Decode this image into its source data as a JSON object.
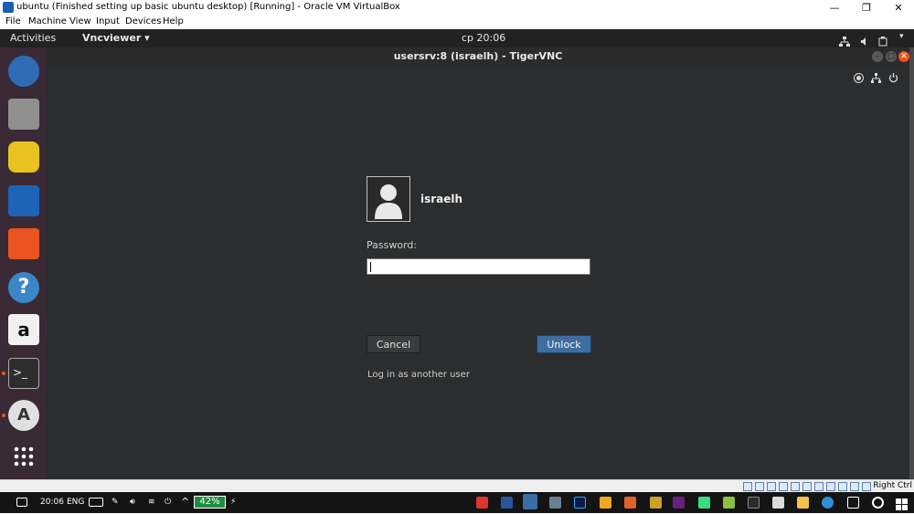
{
  "window": {
    "title": "ubuntu (Finished setting up basic ubuntu desktop) [Running] - Oracle VM VirtualBox",
    "controls": {
      "minimize": "—",
      "maximize": "❐",
      "close": "✕"
    }
  },
  "menu": [
    "File",
    "Machine",
    "View",
    "Input",
    "Devices",
    "Help"
  ],
  "gnome_bar": {
    "activities": "Activities",
    "app_menu": "Vncviewer ▾",
    "clock": "cp 20:06"
  },
  "dock": {
    "items": [
      {
        "name": "Thunderbird",
        "icon": "thunderbird-icon",
        "color": "#2d6db5"
      },
      {
        "name": "Files",
        "icon": "files-icon",
        "color": "#8f8f8f"
      },
      {
        "name": "Rhythmbox",
        "icon": "rhythmbox-icon",
        "color": "#e8c31f"
      },
      {
        "name": "LibreOffice Writer",
        "icon": "writer-icon",
        "color": "#1d63b8"
      },
      {
        "name": "Ubuntu Software",
        "icon": "software-center-icon",
        "color": "#e95420"
      },
      {
        "name": "Help",
        "icon": "help-icon",
        "color": "#3a86c8"
      },
      {
        "name": "Amazon",
        "icon": "amazon-icon",
        "color": "#f0f0f0"
      },
      {
        "name": "Terminal",
        "icon": "terminal-icon",
        "color": "#2e2e2e"
      },
      {
        "name": "Software Updater",
        "icon": "updater-icon",
        "color": "#e0e0e0"
      },
      {
        "name": "Show Applications",
        "icon": "app-grid-icon",
        "color": "#ffffff"
      }
    ]
  },
  "vnc": {
    "title": "usersrv:8 (israelh) - TigerVNC"
  },
  "lock": {
    "username": "israelh",
    "password_label": "Password:",
    "password_value": "",
    "cancel": "Cancel",
    "unlock": "Unlock",
    "another_user": "Log in as another user"
  },
  "vb_status": {
    "host_key": "Right Ctrl"
  },
  "taskbar": {
    "time": "20:06",
    "lang": "ENG",
    "battery": "42%"
  }
}
